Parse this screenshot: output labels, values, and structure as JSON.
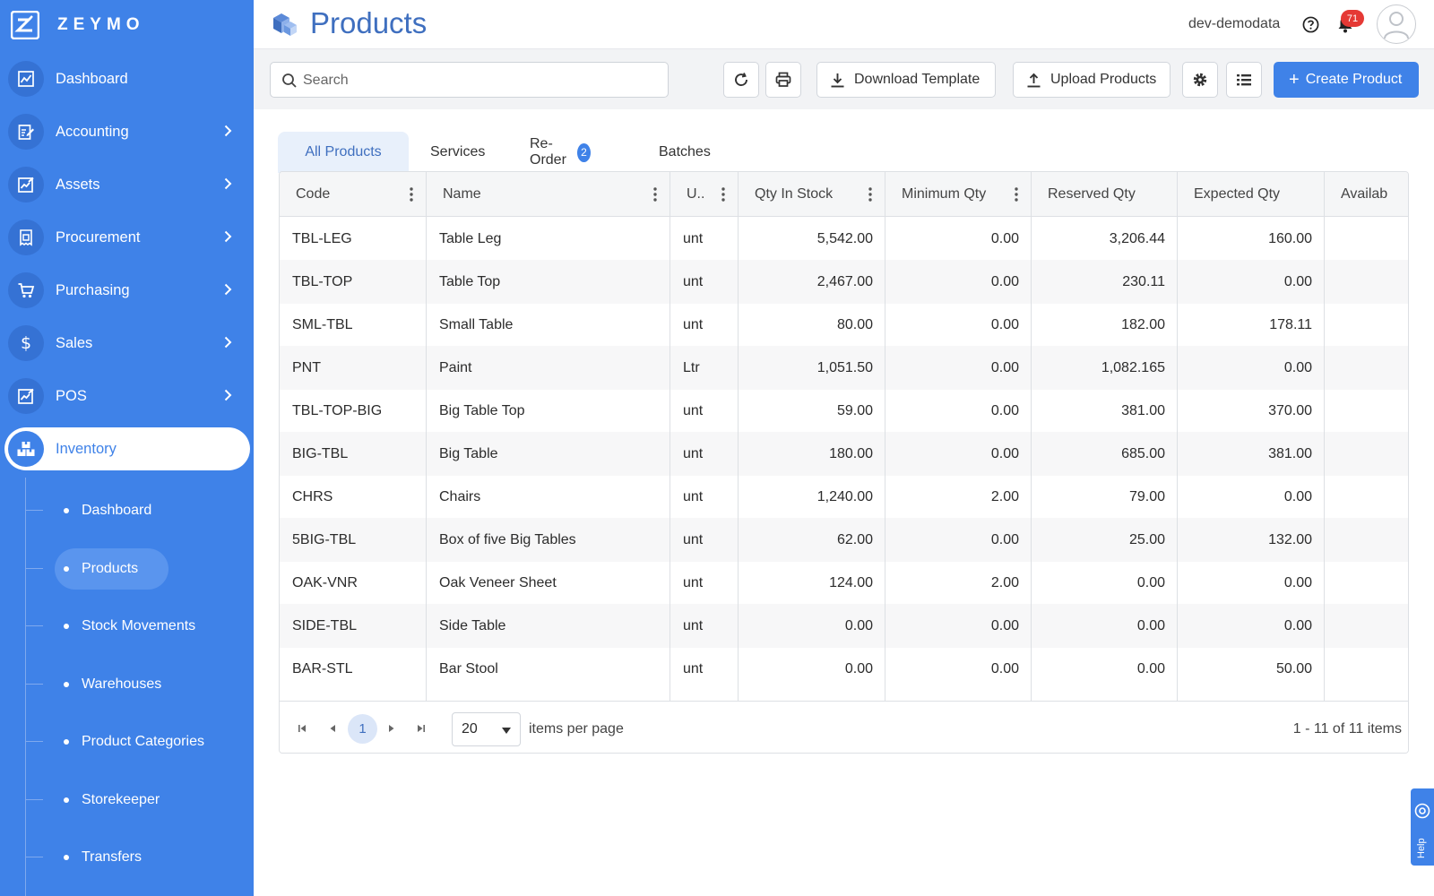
{
  "app": {
    "brand": "ZEYMO"
  },
  "sidebar": {
    "items": [
      {
        "label": "Dashboard",
        "icon": "chart-icon"
      },
      {
        "label": "Accounting",
        "icon": "edit-document-icon"
      },
      {
        "label": "Assets",
        "icon": "asset-chart-icon"
      },
      {
        "label": "Procurement",
        "icon": "invoice-icon"
      },
      {
        "label": "Purchasing",
        "icon": "cart-icon"
      },
      {
        "label": "Sales",
        "icon": "dollar-icon"
      },
      {
        "label": "POS",
        "icon": "pos-icon"
      },
      {
        "label": "Inventory",
        "icon": "boxes-icon",
        "active": true
      }
    ],
    "sub_items": [
      {
        "label": "Dashboard"
      },
      {
        "label": "Products",
        "active": true
      },
      {
        "label": "Stock Movements"
      },
      {
        "label": "Warehouses"
      },
      {
        "label": "Product Categories"
      },
      {
        "label": "Storekeeper"
      },
      {
        "label": "Transfers"
      }
    ]
  },
  "header": {
    "title": "Products",
    "user": "dev-demodata",
    "notification_count": "71"
  },
  "toolbar": {
    "search_placeholder": "Search",
    "download_label": "Download Template",
    "upload_label": "Upload Products",
    "create_label": "Create Product"
  },
  "tabs": [
    {
      "label": "All Products",
      "active": true
    },
    {
      "label": "Services"
    },
    {
      "label": "Re-Order",
      "count": "2"
    },
    {
      "label": "Batches"
    }
  ],
  "table": {
    "columns": [
      "Code",
      "Name",
      "U..",
      "Qty In Stock",
      "Minimum Qty",
      "Reserved Qty",
      "Expected Qty",
      "Availab"
    ],
    "rows": [
      [
        "TBL-LEG",
        "Table Leg",
        "unt",
        "5,542.00",
        "0.00",
        "3,206.44",
        "160.00"
      ],
      [
        "TBL-TOP",
        "Table Top",
        "unt",
        "2,467.00",
        "0.00",
        "230.11",
        "0.00"
      ],
      [
        "SML-TBL",
        "Small Table",
        "unt",
        "80.00",
        "0.00",
        "182.00",
        "178.11"
      ],
      [
        "PNT",
        "Paint",
        "Ltr",
        "1,051.50",
        "0.00",
        "1,082.165",
        "0.00"
      ],
      [
        "TBL-TOP-BIG",
        "Big Table Top",
        "unt",
        "59.00",
        "0.00",
        "381.00",
        "370.00"
      ],
      [
        "BIG-TBL",
        "Big Table",
        "unt",
        "180.00",
        "0.00",
        "685.00",
        "381.00"
      ],
      [
        "CHRS",
        "Chairs",
        "unt",
        "1,240.00",
        "2.00",
        "79.00",
        "0.00"
      ],
      [
        "5BIG-TBL",
        "Box of five Big Tables",
        "unt",
        "62.00",
        "0.00",
        "25.00",
        "132.00"
      ],
      [
        "OAK-VNR",
        "Oak Veneer Sheet",
        "unt",
        "124.00",
        "2.00",
        "0.00",
        "0.00"
      ],
      [
        "SIDE-TBL",
        "Side Table",
        "unt",
        "0.00",
        "0.00",
        "0.00",
        "0.00"
      ],
      [
        "BAR-STL",
        "Bar Stool",
        "unt",
        "0.00",
        "0.00",
        "0.00",
        "50.00"
      ]
    ]
  },
  "pager": {
    "current_page": "1",
    "page_size": "20",
    "page_size_label": "items per page",
    "info": "1 - 11 of 11 items"
  },
  "help_widget": {
    "label": "Help"
  },
  "colors": {
    "accent": "#3f82e8",
    "sidebar": "#3f82e8",
    "badge": "#e53935"
  }
}
